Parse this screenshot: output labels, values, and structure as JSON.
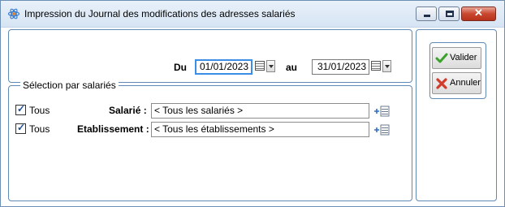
{
  "window": {
    "title": "Impression du Journal des modifications des adresses salariés"
  },
  "dates": {
    "from_label": "Du",
    "from_value": "01/01/2023",
    "to_label": "au",
    "to_value": "31/01/2023"
  },
  "selection": {
    "legend": "Sélection par salariés",
    "rows": [
      {
        "checkbox_label": "Tous",
        "checked": true,
        "field_label": "Salarié :",
        "field_value": "< Tous les salariés >"
      },
      {
        "checkbox_label": "Tous",
        "checked": true,
        "field_label": "Etablissement :",
        "field_value": "< Tous les établissements >"
      }
    ]
  },
  "actions": {
    "validate_label": "Valider",
    "cancel_label": "Annuler"
  },
  "colors": {
    "accent_border": "#5f8ab5",
    "focus_border": "#3a8ee6",
    "close_button": "#c9472f",
    "validate_icon": "#3aa12a",
    "cancel_icon": "#d23a2a"
  },
  "icons": {
    "app": "app-atom-icon",
    "minimize": "minimize-icon",
    "maximize": "maximize-icon",
    "close": "close-icon",
    "calendar": "calendar-icon",
    "list_select": "list-select-icon",
    "check": "check-icon",
    "cross": "cross-icon"
  }
}
